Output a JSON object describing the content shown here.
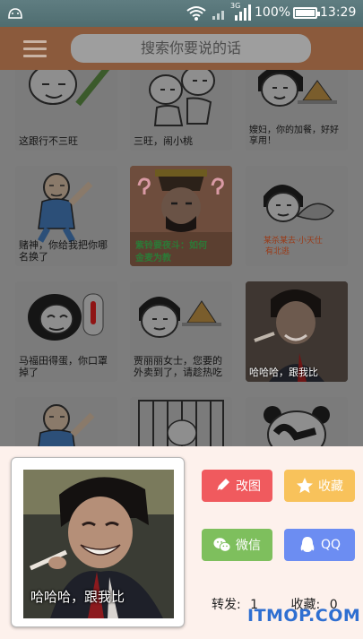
{
  "status_bar": {
    "wifi_icon": "wifi-icon",
    "network_label": "3G",
    "battery": "100%",
    "time": "13:29"
  },
  "header": {
    "search_placeholder": "搜索你要说的话"
  },
  "grid": {
    "items": [
      {
        "caption": "这跟行不三旺"
      },
      {
        "caption": "三旺，闹小桃"
      },
      {
        "caption": "嫂妇，你的加餐，好好享用！"
      },
      {
        "caption": "赌神，你给我把你哪名换了"
      },
      {
        "caption": ""
      },
      {
        "caption": ""
      },
      {
        "caption": "马福田得蛋，你口罩掉了"
      },
      {
        "caption": "贾丽丽女士，您要的外卖到了，请趁热吃"
      },
      {
        "caption": "哈哈哈，跟我比"
      },
      {
        "caption": ""
      },
      {
        "caption": ""
      },
      {
        "caption": ""
      }
    ],
    "image_texts": {
      "bao": "紫铃要夜斗：如何",
      "bao2": "金麦为教",
      "dumpling": "某杀某去·小天仕",
      "dumpling2": "有北逃"
    }
  },
  "detail": {
    "caption": "哈哈哈，跟我比",
    "buttons": {
      "edit": "改图",
      "favorite": "收藏",
      "wechat": "微信",
      "qq": "QQ"
    },
    "forward_label": "转发:",
    "forward_count": "1",
    "favorite_label": "收藏:",
    "favorite_count": "0"
  },
  "watermark": "ITMOP.COM",
  "colors": {
    "edit": "#f05a5e",
    "favorite": "#f8c25b",
    "wechat": "#7ebf5d",
    "qq": "#6c8df2",
    "header": "#8b5a3c"
  }
}
